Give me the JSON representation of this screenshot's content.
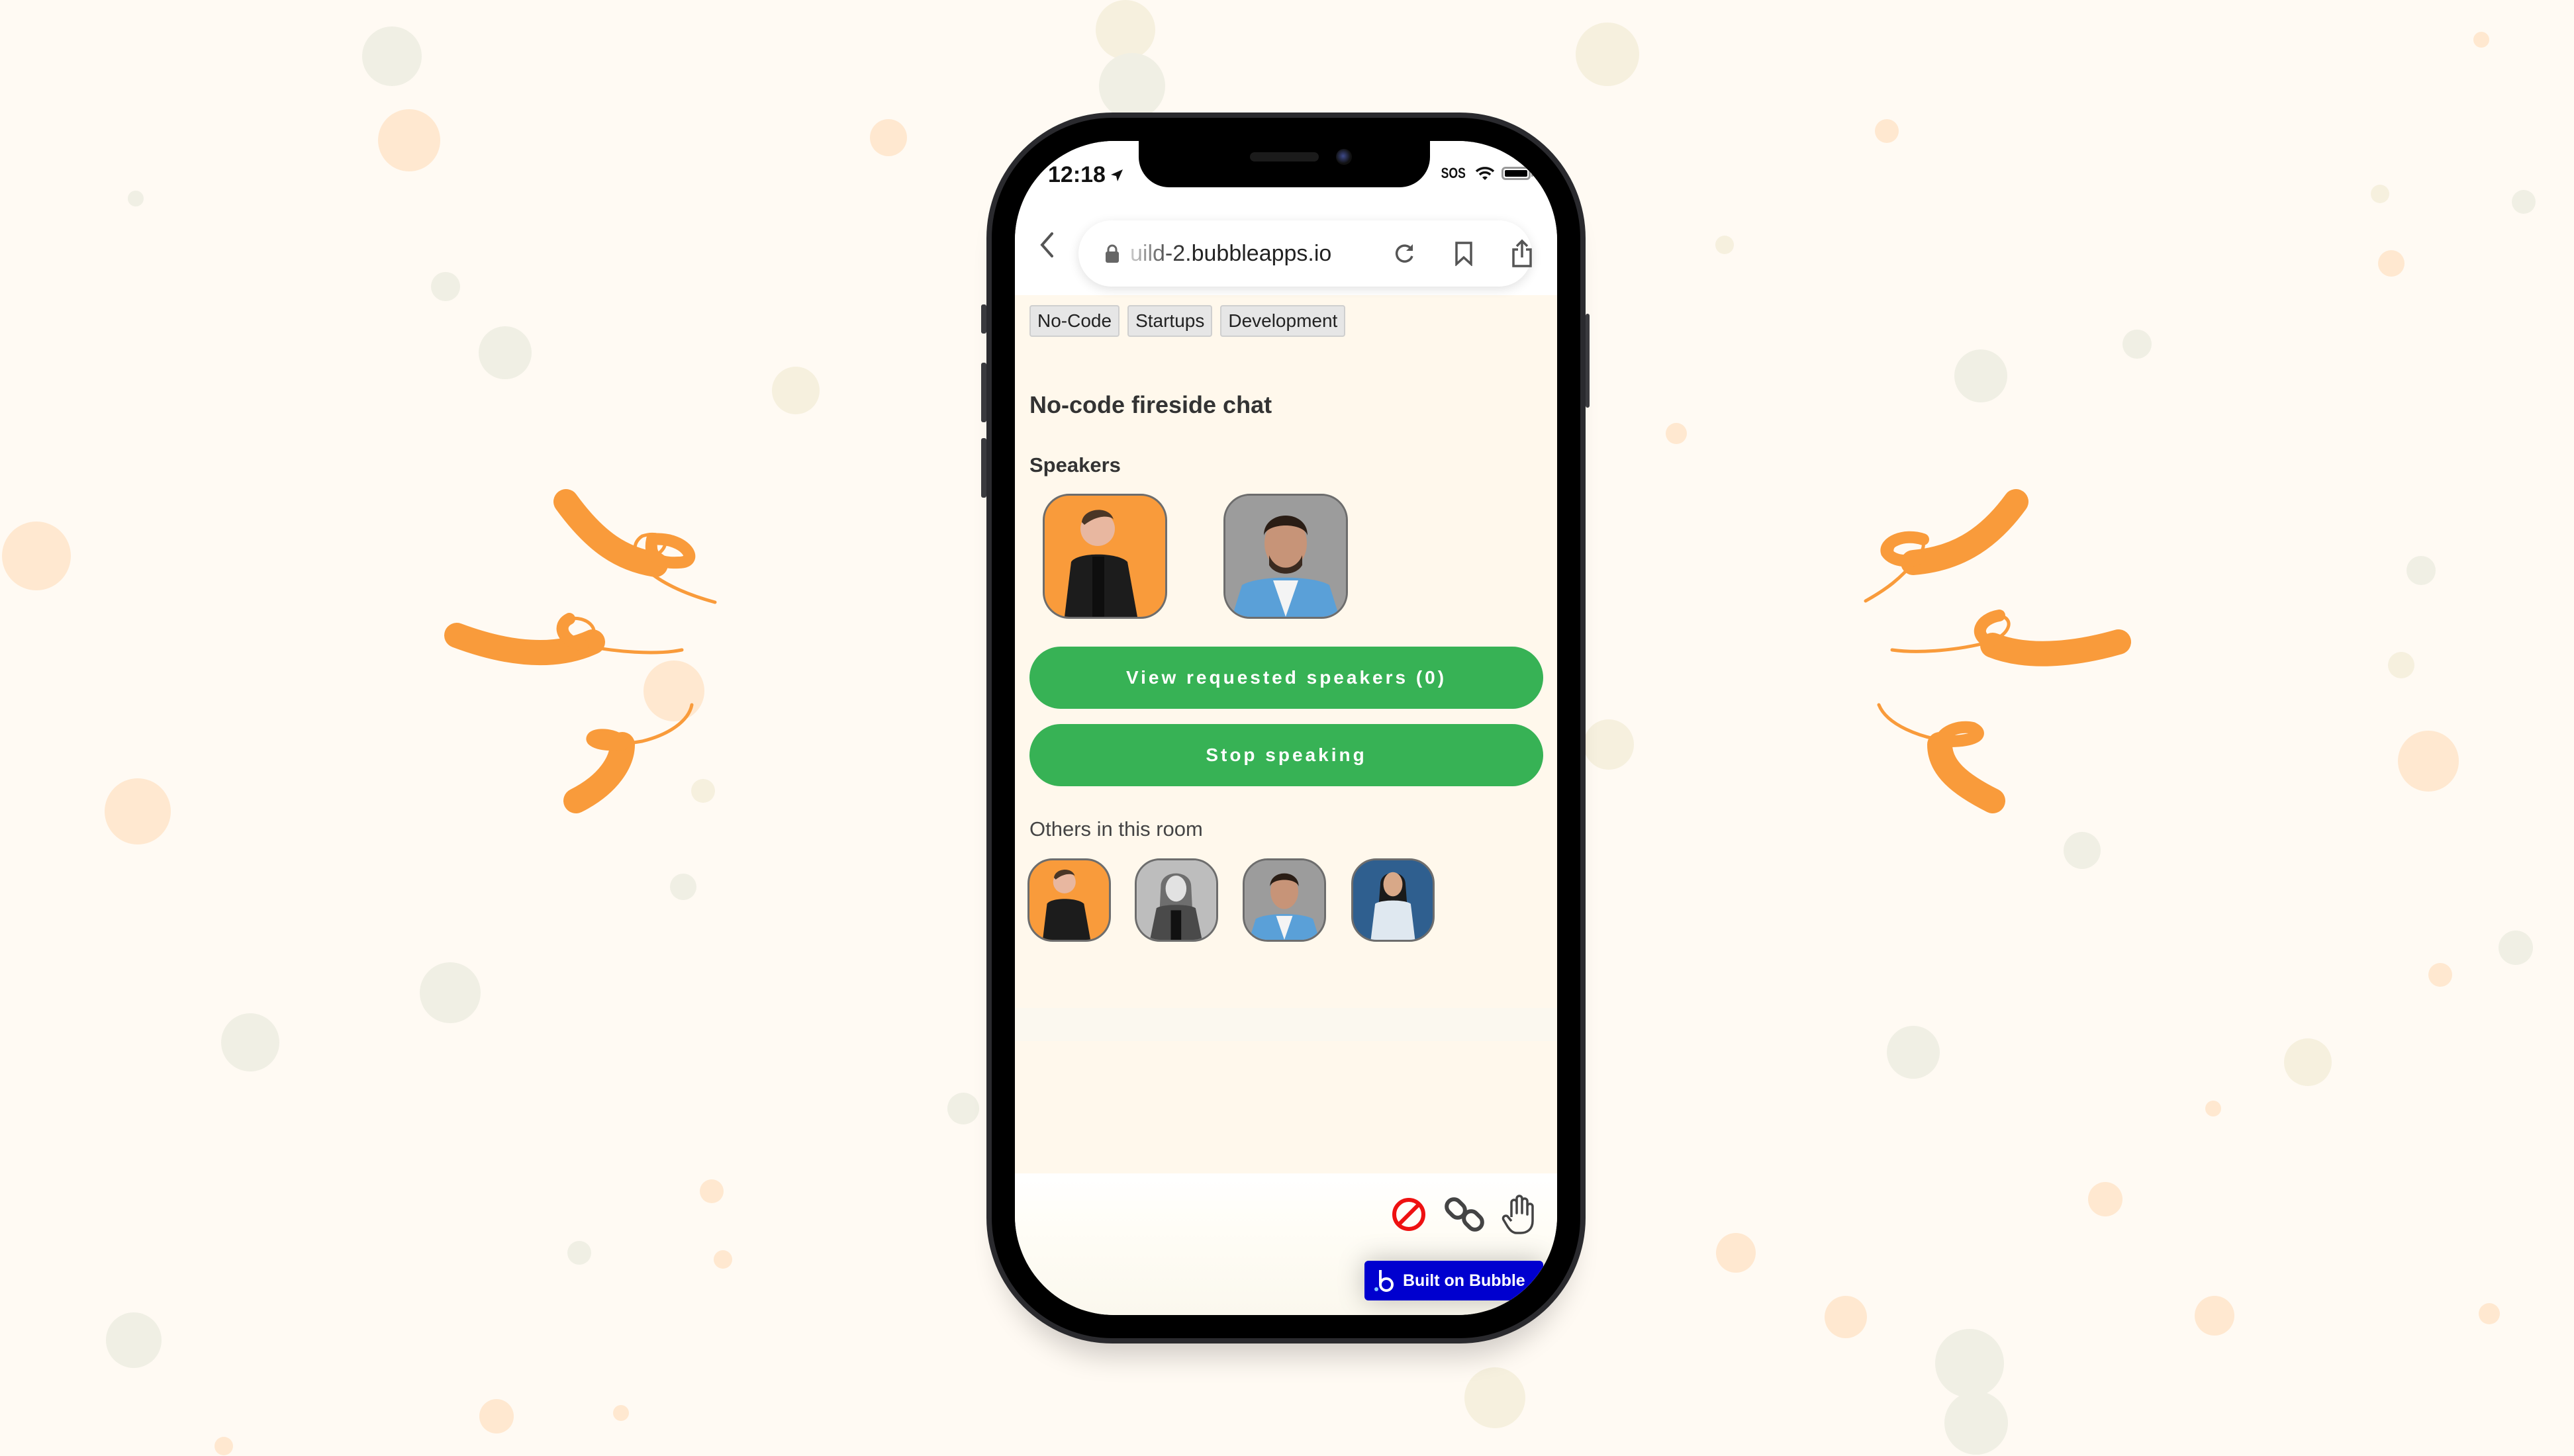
{
  "status_bar": {
    "time": "12:18",
    "location_icon": "location-arrow-icon",
    "carrier": "SOS",
    "wifi_icon": "wifi-icon",
    "battery_icon": "battery-icon"
  },
  "browser": {
    "url": "uild-2.bubbleapps.io",
    "back_icon": "chevron-left-icon",
    "lock_icon": "lock-icon",
    "reload_icon": "reload-icon",
    "bookmark_icon": "bookmark-icon",
    "share_icon": "share-icon"
  },
  "room": {
    "tags": [
      "No-Code",
      "Startups",
      "Development"
    ],
    "title": "No-code fireside chat",
    "speakers_label": "Speakers",
    "speakers": [
      {
        "avatar": "man-black-jacket-orange-bg"
      },
      {
        "avatar": "smiling-man-blue-shirt"
      }
    ],
    "view_requested_label": "View requested speakers (0)",
    "stop_speaking_label": "Stop speaking",
    "others_label": "Others in this room",
    "others": [
      {
        "avatar": "man-black-jacket-orange-bg"
      },
      {
        "avatar": "woman-long-hair-bw"
      },
      {
        "avatar": "smiling-man-blue-shirt"
      },
      {
        "avatar": "woman-white-tshirt-blue-bg"
      }
    ]
  },
  "toolbar": {
    "icons": [
      "mute-icon",
      "link-icon",
      "raise-hand-icon"
    ]
  },
  "badge": {
    "label": "Built on Bubble"
  },
  "colors": {
    "background": "#fffaf3",
    "accent_orange": "#f99b3b",
    "button_green": "#37b255",
    "bubble_blue": "#0000cf",
    "mute_red": "#ee1111"
  }
}
